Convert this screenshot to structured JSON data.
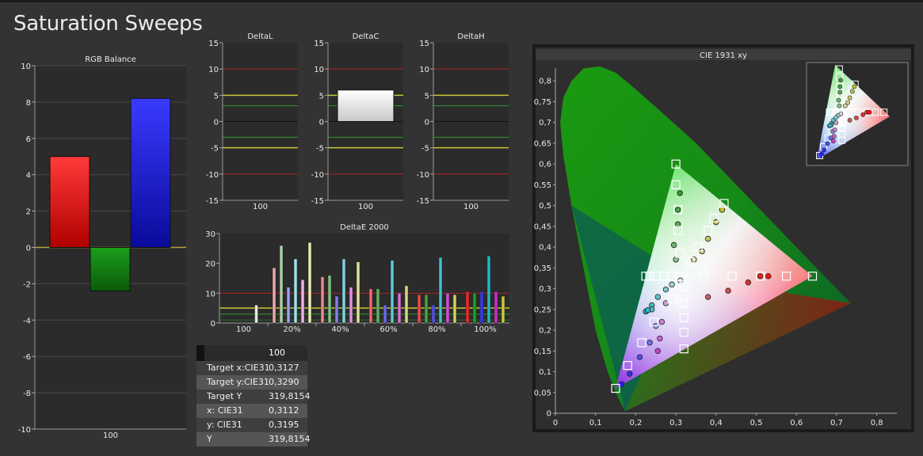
{
  "page": {
    "title": "Saturation Sweeps"
  },
  "colors": {
    "red": "#ff2020",
    "green": "#1a9a1a",
    "blue": "#2a2aff",
    "yellow_line": "#c8c832",
    "red_line": "#b42020",
    "green_line": "#2e9a2e"
  },
  "chart_data": [
    {
      "id": "rgb",
      "type": "bar",
      "title": "RGB Balance",
      "categories": [
        "100"
      ],
      "series": [
        {
          "values": [
            5.0
          ],
          "color": "#ff2020"
        },
        {
          "values": [
            -2.4
          ],
          "color": "#18901a"
        },
        {
          "values": [
            8.2
          ],
          "color": "#2a2aff"
        }
      ],
      "ylim": [
        -10,
        10
      ],
      "yticks": [
        "10",
        "8",
        "6",
        "4",
        "2",
        "0",
        "-2",
        "-4",
        "-6",
        "-8",
        "-10"
      ],
      "grid": true
    },
    {
      "id": "deltaL",
      "type": "bar",
      "title": "DeltaL",
      "categories": [
        "100"
      ],
      "values": [
        0
      ],
      "ylim": [
        -15,
        15
      ],
      "yticks": [
        "15",
        "10",
        "5",
        "0",
        "-5",
        "-10",
        "-15"
      ]
    },
    {
      "id": "deltaC",
      "type": "bar",
      "title": "DeltaC",
      "categories": [
        "100"
      ],
      "values": [
        6
      ],
      "ylim": [
        -15,
        15
      ],
      "yticks": [
        "15",
        "10",
        "5",
        "0",
        "-5",
        "-10",
        "-15"
      ]
    },
    {
      "id": "deltaH",
      "type": "bar",
      "title": "DeltaH",
      "categories": [
        "100"
      ],
      "values": [
        0
      ],
      "ylim": [
        -15,
        15
      ],
      "yticks": [
        "15",
        "10",
        "5",
        "0",
        "-5",
        "-10",
        "-15"
      ]
    },
    {
      "id": "deltaE",
      "type": "bar",
      "title": "DeltaE 2000",
      "categories": [
        "100",
        "20%",
        "40%",
        "60%",
        "80%",
        "100%"
      ],
      "groups": [
        [
          {
            "v": 6.0,
            "c": "#e8e8e8"
          }
        ],
        [
          {
            "v": 18.5,
            "c": "#f0a8a8"
          },
          {
            "v": 26.0,
            "c": "#a8d0a8"
          },
          {
            "v": 12.0,
            "c": "#a0a0ee"
          },
          {
            "v": 21.5,
            "c": "#a0e0e8"
          },
          {
            "v": 14.5,
            "c": "#ecb0ec"
          },
          {
            "v": 27.0,
            "c": "#e8e8b0"
          }
        ],
        [
          {
            "v": 15.5,
            "c": "#f08888"
          },
          {
            "v": 16.0,
            "c": "#80c080"
          },
          {
            "v": 9.0,
            "c": "#8080ee"
          },
          {
            "v": 21.5,
            "c": "#80d0e0"
          },
          {
            "v": 12.0,
            "c": "#e090e0"
          },
          {
            "v": 20.5,
            "c": "#e0e098"
          }
        ],
        [
          {
            "v": 11.5,
            "c": "#f06868"
          },
          {
            "v": 11.5,
            "c": "#60b060"
          },
          {
            "v": 6.0,
            "c": "#6868ee"
          },
          {
            "v": 21.0,
            "c": "#60c8d8"
          },
          {
            "v": 10.0,
            "c": "#d870d8"
          },
          {
            "v": 12.5,
            "c": "#d8d880"
          }
        ],
        [
          {
            "v": 9.5,
            "c": "#f04848"
          },
          {
            "v": 9.5,
            "c": "#40a840"
          },
          {
            "v": 6.0,
            "c": "#5050ee"
          },
          {
            "v": 22.0,
            "c": "#40c0d0"
          },
          {
            "v": 10.0,
            "c": "#d050d0"
          },
          {
            "v": 9.5,
            "c": "#d0d060"
          }
        ],
        [
          {
            "v": 10.5,
            "c": "#f02828"
          },
          {
            "v": 10.0,
            "c": "#20a020"
          },
          {
            "v": 10.5,
            "c": "#3838f0"
          },
          {
            "v": 22.5,
            "c": "#20b8c8"
          },
          {
            "v": 10.5,
            "c": "#c830c8"
          },
          {
            "v": 9.0,
            "c": "#c8c840"
          }
        ]
      ],
      "ylim": [
        0,
        30
      ],
      "yticks": [
        "30",
        "20",
        "10",
        "0"
      ]
    },
    {
      "id": "cie",
      "type": "scatter",
      "title": "CIE 1931 xy",
      "xlim": [
        0,
        0.85
      ],
      "ylim": [
        0,
        0.85
      ],
      "xticks": [
        "0",
        "0,1",
        "0,2",
        "0,3",
        "0,4",
        "0,5",
        "0,6",
        "0,7",
        "0,8"
      ],
      "yticks": [
        "0,8",
        "0,75",
        "0,7",
        "0,65",
        "0,6",
        "0,55",
        "0,5",
        "0,45",
        "0,4",
        "0,35",
        "0,3",
        "0,25",
        "0,2",
        "0,15",
        "0,1",
        "0,05",
        "0"
      ],
      "targets": [
        [
          0.3127,
          0.329
        ],
        [
          0.3127,
          0.329
        ],
        [
          0.37,
          0.33
        ],
        [
          0.44,
          0.33
        ],
        [
          0.51,
          0.33
        ],
        [
          0.575,
          0.33
        ],
        [
          0.64,
          0.33
        ],
        [
          0.31,
          0.385
        ],
        [
          0.305,
          0.44
        ],
        [
          0.305,
          0.49
        ],
        [
          0.3,
          0.55
        ],
        [
          0.3,
          0.6
        ],
        [
          0.29,
          0.33
        ],
        [
          0.27,
          0.33
        ],
        [
          0.25,
          0.33
        ],
        [
          0.235,
          0.33
        ],
        [
          0.225,
          0.33
        ],
        [
          0.29,
          0.275
        ],
        [
          0.245,
          0.22
        ],
        [
          0.215,
          0.17
        ],
        [
          0.18,
          0.115
        ],
        [
          0.15,
          0.06
        ],
        [
          0.32,
          0.305
        ],
        [
          0.32,
          0.265
        ],
        [
          0.32,
          0.23
        ],
        [
          0.32,
          0.195
        ],
        [
          0.32,
          0.155
        ],
        [
          0.335,
          0.365
        ],
        [
          0.355,
          0.4
        ],
        [
          0.38,
          0.44
        ],
        [
          0.395,
          0.47
        ],
        [
          0.42,
          0.505
        ]
      ],
      "measured": [
        {
          "x": 0.3112,
          "y": 0.3195,
          "c": "#dddddd"
        },
        {
          "x": 0.38,
          "y": 0.28,
          "c": "#c06060"
        },
        {
          "x": 0.43,
          "y": 0.295,
          "c": "#d05050"
        },
        {
          "x": 0.48,
          "y": 0.315,
          "c": "#e03030"
        },
        {
          "x": 0.51,
          "y": 0.33,
          "c": "#ee2020"
        },
        {
          "x": 0.53,
          "y": 0.33,
          "c": "#ff1010"
        },
        {
          "x": 0.3,
          "y": 0.37,
          "c": "#90c090"
        },
        {
          "x": 0.295,
          "y": 0.405,
          "c": "#70b870"
        },
        {
          "x": 0.305,
          "y": 0.455,
          "c": "#50b050"
        },
        {
          "x": 0.305,
          "y": 0.49,
          "c": "#40a840"
        },
        {
          "x": 0.31,
          "y": 0.53,
          "c": "#30a030"
        },
        {
          "x": 0.29,
          "y": 0.31,
          "c": "#a0d0d8"
        },
        {
          "x": 0.275,
          "y": 0.298,
          "c": "#80c8d0"
        },
        {
          "x": 0.255,
          "y": 0.28,
          "c": "#60c0c8"
        },
        {
          "x": 0.24,
          "y": 0.26,
          "c": "#40b8c0"
        },
        {
          "x": 0.225,
          "y": 0.245,
          "c": "#20b0c0"
        },
        {
          "x": 0.24,
          "y": 0.25,
          "c": "#50bcc4"
        },
        {
          "x": 0.23,
          "y": 0.248,
          "c": "#30b4c2"
        },
        {
          "x": 0.25,
          "y": 0.21,
          "c": "#9090e0"
        },
        {
          "x": 0.235,
          "y": 0.17,
          "c": "#7070e8"
        },
        {
          "x": 0.21,
          "y": 0.135,
          "c": "#5050ee"
        },
        {
          "x": 0.185,
          "y": 0.095,
          "c": "#3030f0"
        },
        {
          "x": 0.165,
          "y": 0.07,
          "c": "#2020f0"
        },
        {
          "x": 0.275,
          "y": 0.265,
          "c": "#d0a0d0"
        },
        {
          "x": 0.265,
          "y": 0.22,
          "c": "#d080d0"
        },
        {
          "x": 0.26,
          "y": 0.18,
          "c": "#d060d0"
        },
        {
          "x": 0.255,
          "y": 0.15,
          "c": "#c840c8"
        },
        {
          "x": 0.345,
          "y": 0.37,
          "c": "#d8d8a0"
        },
        {
          "x": 0.365,
          "y": 0.39,
          "c": "#d0d080"
        },
        {
          "x": 0.38,
          "y": 0.42,
          "c": "#c8c860"
        },
        {
          "x": 0.4,
          "y": 0.46,
          "c": "#c0c040"
        },
        {
          "x": 0.415,
          "y": 0.49,
          "c": "#c0c020"
        }
      ]
    }
  ],
  "measurements": {
    "header": "100",
    "rows": [
      {
        "label": "Target x:CIE31",
        "value": "0,3127"
      },
      {
        "label": "Target y:CIE31",
        "value": "0,3290"
      },
      {
        "label": "Target Y",
        "value": "319,8154"
      },
      {
        "label": "x: CIE31",
        "value": "0,3112"
      },
      {
        "label": "y: CIE31",
        "value": "0,3195"
      },
      {
        "label": "Y",
        "value": "319,8154"
      }
    ]
  }
}
